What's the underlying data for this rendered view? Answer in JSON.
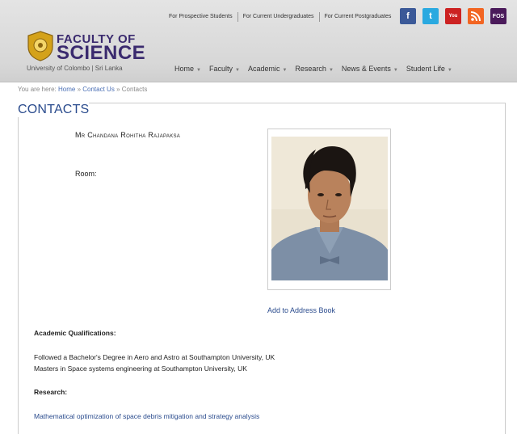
{
  "top_links": [
    "For Prospective Students",
    "For Current Undergraduates",
    "For Current Postgraduates"
  ],
  "social": {
    "facebook": "f",
    "twitter": "t",
    "youtube": "You",
    "rss": "",
    "fos": "FOS"
  },
  "logo": {
    "line1": "FACULTY OF",
    "line2": "SCIENCE",
    "sub": "University of Colombo | Sri Lanka"
  },
  "nav": [
    "Home",
    "Faculty",
    "Academic",
    "Research",
    "News & Events",
    "Student Life"
  ],
  "breadcrumb": {
    "prefix": "You are here:",
    "home": "Home",
    "sep1": "»",
    "contact_us": "Contact Us",
    "sep2": "»",
    "current": "Contacts"
  },
  "page": {
    "title": "CONTACTS",
    "name": "Mr Chandana Rohitha Rajapaksa",
    "room_label": "Room:",
    "add_to_address_book": "Add to Address Book",
    "qualifications_label": "Academic Qualifications:",
    "qualifications": [
      "Followed a Bachelor's Degree in Aero and Astro at Southampton University, UK",
      "Masters in Space systems engineering at Southampton University, UK"
    ],
    "research_label": "Research:",
    "research_link": "Mathematical optimization of space debris mitigation and strategy analysis"
  }
}
